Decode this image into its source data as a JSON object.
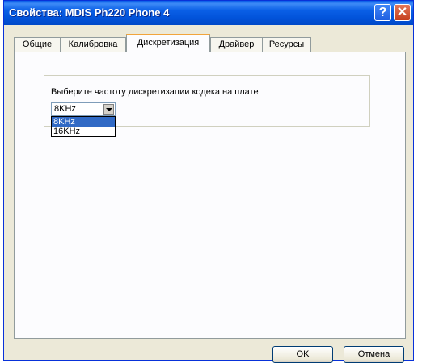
{
  "window": {
    "title": "Свойства: MDIS Ph220 Phone 4",
    "help_label": "?",
    "close_label": "✕"
  },
  "tabs": [
    {
      "label": "Общие"
    },
    {
      "label": "Калибровка"
    },
    {
      "label": "Дискретизация",
      "active": true
    },
    {
      "label": "Драйвер"
    },
    {
      "label": "Ресурсы"
    }
  ],
  "panel": {
    "group_label": "Выберите частоту дискретизации кодека на плате",
    "combo_value": "8KHz",
    "options": [
      "8KHz",
      "16KHz"
    ],
    "selected_option": "8KHz"
  },
  "buttons": {
    "ok_label": "OK",
    "cancel_label": "Отмена"
  },
  "colors": {
    "titlebar": "#0a5fe6",
    "selection": "#316ac5",
    "active_tab_accent": "#f1a43b"
  }
}
